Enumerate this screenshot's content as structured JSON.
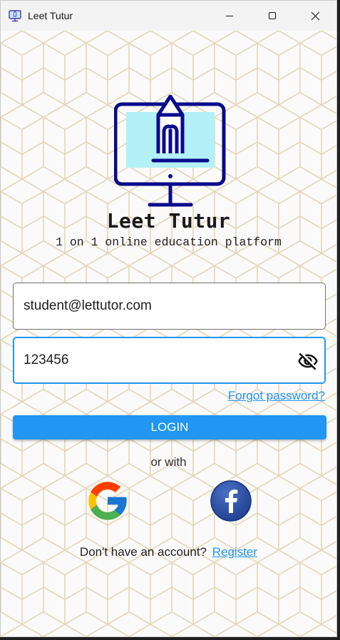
{
  "window": {
    "title": "Leet Tutur"
  },
  "brand": {
    "name": "Leet Tutur",
    "tagline": "1 on 1 online education platform"
  },
  "form": {
    "email_value": "student@lettutor.com",
    "password_value": "123456",
    "forgot_label": "Forgot password?",
    "login_label": "LOGIN",
    "or_with_label": "or with",
    "no_account_label": "Don't have an account?",
    "register_label": "Register"
  },
  "icons": {
    "app": "computer-pencil-icon",
    "minimize": "minimize-icon",
    "maximize": "maximize-icon",
    "close": "close-icon",
    "password_toggle": "eye-off-icon",
    "google": "google-icon",
    "facebook": "facebook-icon"
  },
  "colors": {
    "accent": "#2196f3",
    "logo_navy": "#0a0a8c",
    "logo_screen": "#b3f0f7",
    "pattern_line": "#e3d6b8"
  }
}
